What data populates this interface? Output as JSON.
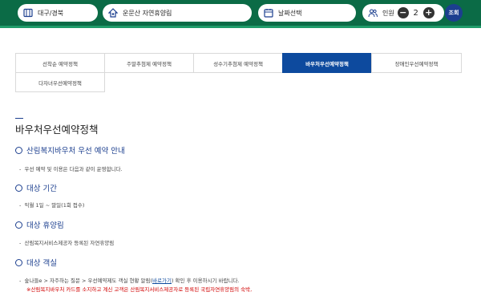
{
  "header": {
    "region": "대구/경북",
    "forest": "운문산 자연휴양림",
    "date_placeholder": "날짜선택",
    "people_label": "인원",
    "people_count": "2",
    "minus": "−",
    "plus": "+",
    "search_label": "조회"
  },
  "tabs": [
    {
      "label": "선착순 예약정책",
      "active": false
    },
    {
      "label": "주말추첨제 예약정책",
      "active": false
    },
    {
      "label": "성수기추첨제 예약정책",
      "active": false
    },
    {
      "label": "바우처우선예약정책",
      "active": true
    },
    {
      "label": "장애인우선예약정책",
      "active": false
    },
    {
      "label": "다자녀우선예약정책",
      "active": false
    }
  ],
  "page_title": "바우처우선예약정책",
  "sections": [
    {
      "heading": "산림복지바우처 우선 예약 안내",
      "text": "우선 예약 및 이용은 다음과 같이 운영합니다."
    },
    {
      "heading": "대상 기간",
      "text": "익월 1일 ~ 말일(1회 접수)"
    },
    {
      "heading": "대상 휴양림",
      "text": "산림복지서비스제공자 등록된 자연휴양림"
    },
    {
      "heading": "대상 객실",
      "text_before": "숲나들e > 자주하는 질문 > 우선예약제도 객실 현황 알림(",
      "link": "바로가기",
      "text_after": ") 확인 후 이용하시기 바랍니다."
    }
  ],
  "notice": "※산림복지바우처 카드를 소지하고 계신 고객은 산림복지서비스제공자로 등록된 국립자연휴양림의 숙박,",
  "colors": {
    "header_bg": "#0b6b46",
    "accent_line": "#1f9c6a",
    "active_tab": "#0d4a9e",
    "heading": "#1c3f8f",
    "notice": "#d10000"
  },
  "icons": [
    "map-icon",
    "forest-icon",
    "calendar-icon",
    "people-icon"
  ]
}
